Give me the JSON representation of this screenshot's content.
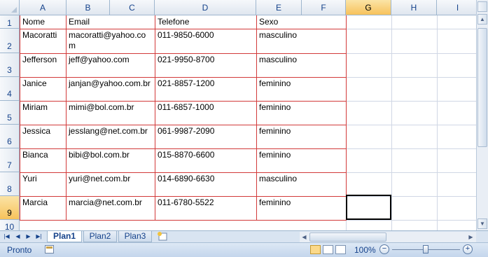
{
  "columns": [
    "A",
    "B",
    "C",
    "D",
    "E",
    "F",
    "G",
    "H",
    "I"
  ],
  "selected_column": "G",
  "rows": [
    "1",
    "2",
    "3",
    "4",
    "5",
    "6",
    "7",
    "8",
    "9",
    "10"
  ],
  "selected_row": "9",
  "header": {
    "nome": "Nome",
    "email": "Email",
    "telefone": "Telefone",
    "sexo": "Sexo"
  },
  "records": [
    {
      "nome": "Macoratti",
      "email": "macoratti@yahoo.com",
      "telefone": "011-9850-6000",
      "sexo": "masculino"
    },
    {
      "nome": "Jefferson",
      "email": "jeff@yahoo.com",
      "telefone": "021-9950-8700",
      "sexo": "masculino"
    },
    {
      "nome": "Janice",
      "email": "janjan@yahoo.com.br",
      "telefone": "021-8857-1200",
      "sexo": "feminino"
    },
    {
      "nome": "Miriam",
      "email": "mimi@bol.com.br",
      "telefone": "011-6857-1000",
      "sexo": "feminino"
    },
    {
      "nome": "Jessica",
      "email": "jesslang@net.com.br",
      "telefone": "061-9987-2090",
      "sexo": "feminino"
    },
    {
      "nome": "Bianca",
      "email": "bibi@bol.com.br",
      "telefone": "015-8870-6600",
      "sexo": "feminino"
    },
    {
      "nome": "Yuri",
      "email": "yuri@net.com.br",
      "telefone": "014-6890-6630",
      "sexo": "masculino"
    },
    {
      "nome": "Marcia",
      "email": "marcia@net.com.br",
      "telefone": "011-6780-5522",
      "sexo": "feminino"
    }
  ],
  "sheet_tabs": [
    "Plan1",
    "Plan2",
    "Plan3"
  ],
  "active_tab": "Plan1",
  "status": {
    "text": "Pronto",
    "zoom": "100%"
  },
  "colors": {
    "border_red": "#d23a3a",
    "grid": "#d0d7e5",
    "header_blue": "#15428b",
    "selection": "#f7c25b"
  },
  "icons": [
    "first-sheet-icon",
    "prev-sheet-icon",
    "next-sheet-icon",
    "last-sheet-icon",
    "insert-sheet-icon",
    "macro-record-icon",
    "normal-view-icon",
    "page-layout-view-icon",
    "page-break-view-icon",
    "zoom-out-icon",
    "zoom-in-icon"
  ]
}
